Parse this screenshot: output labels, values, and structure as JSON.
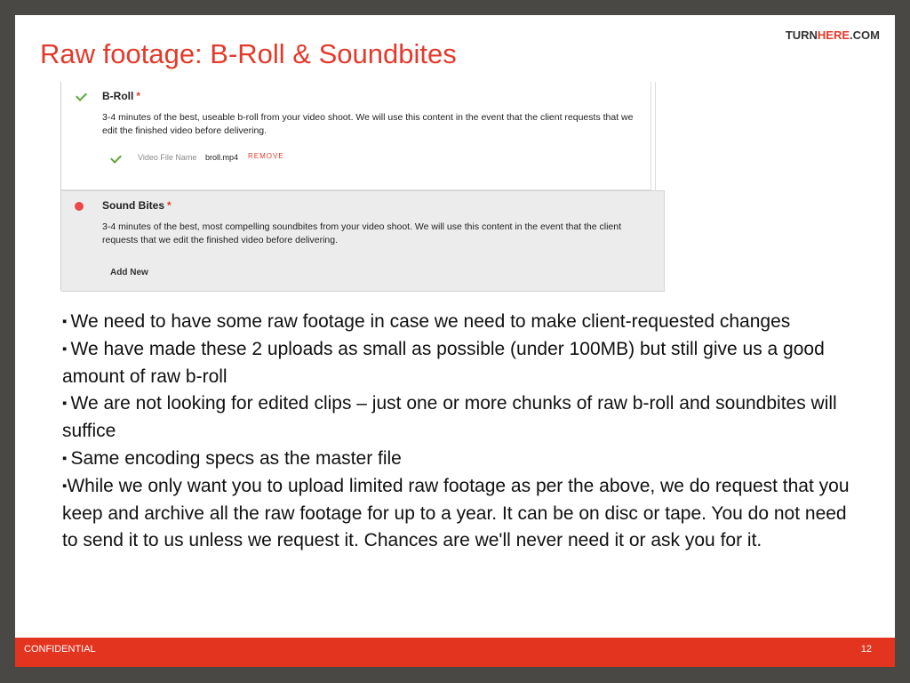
{
  "header": {
    "title": "Raw footage: B-Roll & Soundbites",
    "brand_prefix": "TURN",
    "brand_highlight": "HERE",
    "brand_suffix": ".COM"
  },
  "form": {
    "broll": {
      "title": "B-Roll",
      "required_mark": "*",
      "description": "3-4 minutes of the best, useable b-roll from your video shoot. We will use this content in the event that the client requests that we edit the finished video before delivering.",
      "file_label": "Video File Name",
      "file_name": "broll.mp4",
      "remove_label": "REMOVE"
    },
    "soundbites": {
      "title": "Sound Bites",
      "required_mark": "*",
      "description": "3-4 minutes of the best, most compelling soundbites from your video shoot. We will use this content in the event that the client requests that we edit the finished video before delivering.",
      "add_label": "Add New"
    }
  },
  "bullets": [
    {
      "marker": "▪ ",
      "text": "We need to have some raw footage in case we need to make client-requested changes"
    },
    {
      "marker": "▪ ",
      "text": "We have made these 2 uploads as small as possible (under 100MB) but still give us a good amount of raw b-roll"
    },
    {
      "marker": "▪ ",
      "text": "We are not looking for edited clips – just one or more chunks of raw b-roll and soundbites will suffice"
    },
    {
      "marker": "▪ ",
      "text": "Same encoding specs as the master file"
    },
    {
      "marker": "▪",
      "text": "While we only want you to upload limited raw footage as per the above, we do request that you keep and archive all the raw footage for up to a year. It can be on disc or tape. You do not need to send it to us unless we request it. Chances are we'll never need it or ask you for it."
    }
  ],
  "footer": {
    "confidential": "CONFIDENTIAL",
    "page_number": "12"
  },
  "colors": {
    "accent": "#e43a2b",
    "footer_bg": "#e3341f",
    "check": "#5aa837",
    "status_dot": "#e8484a"
  },
  "icons": {
    "complete": "check-icon",
    "incomplete": "status-dot-icon"
  }
}
